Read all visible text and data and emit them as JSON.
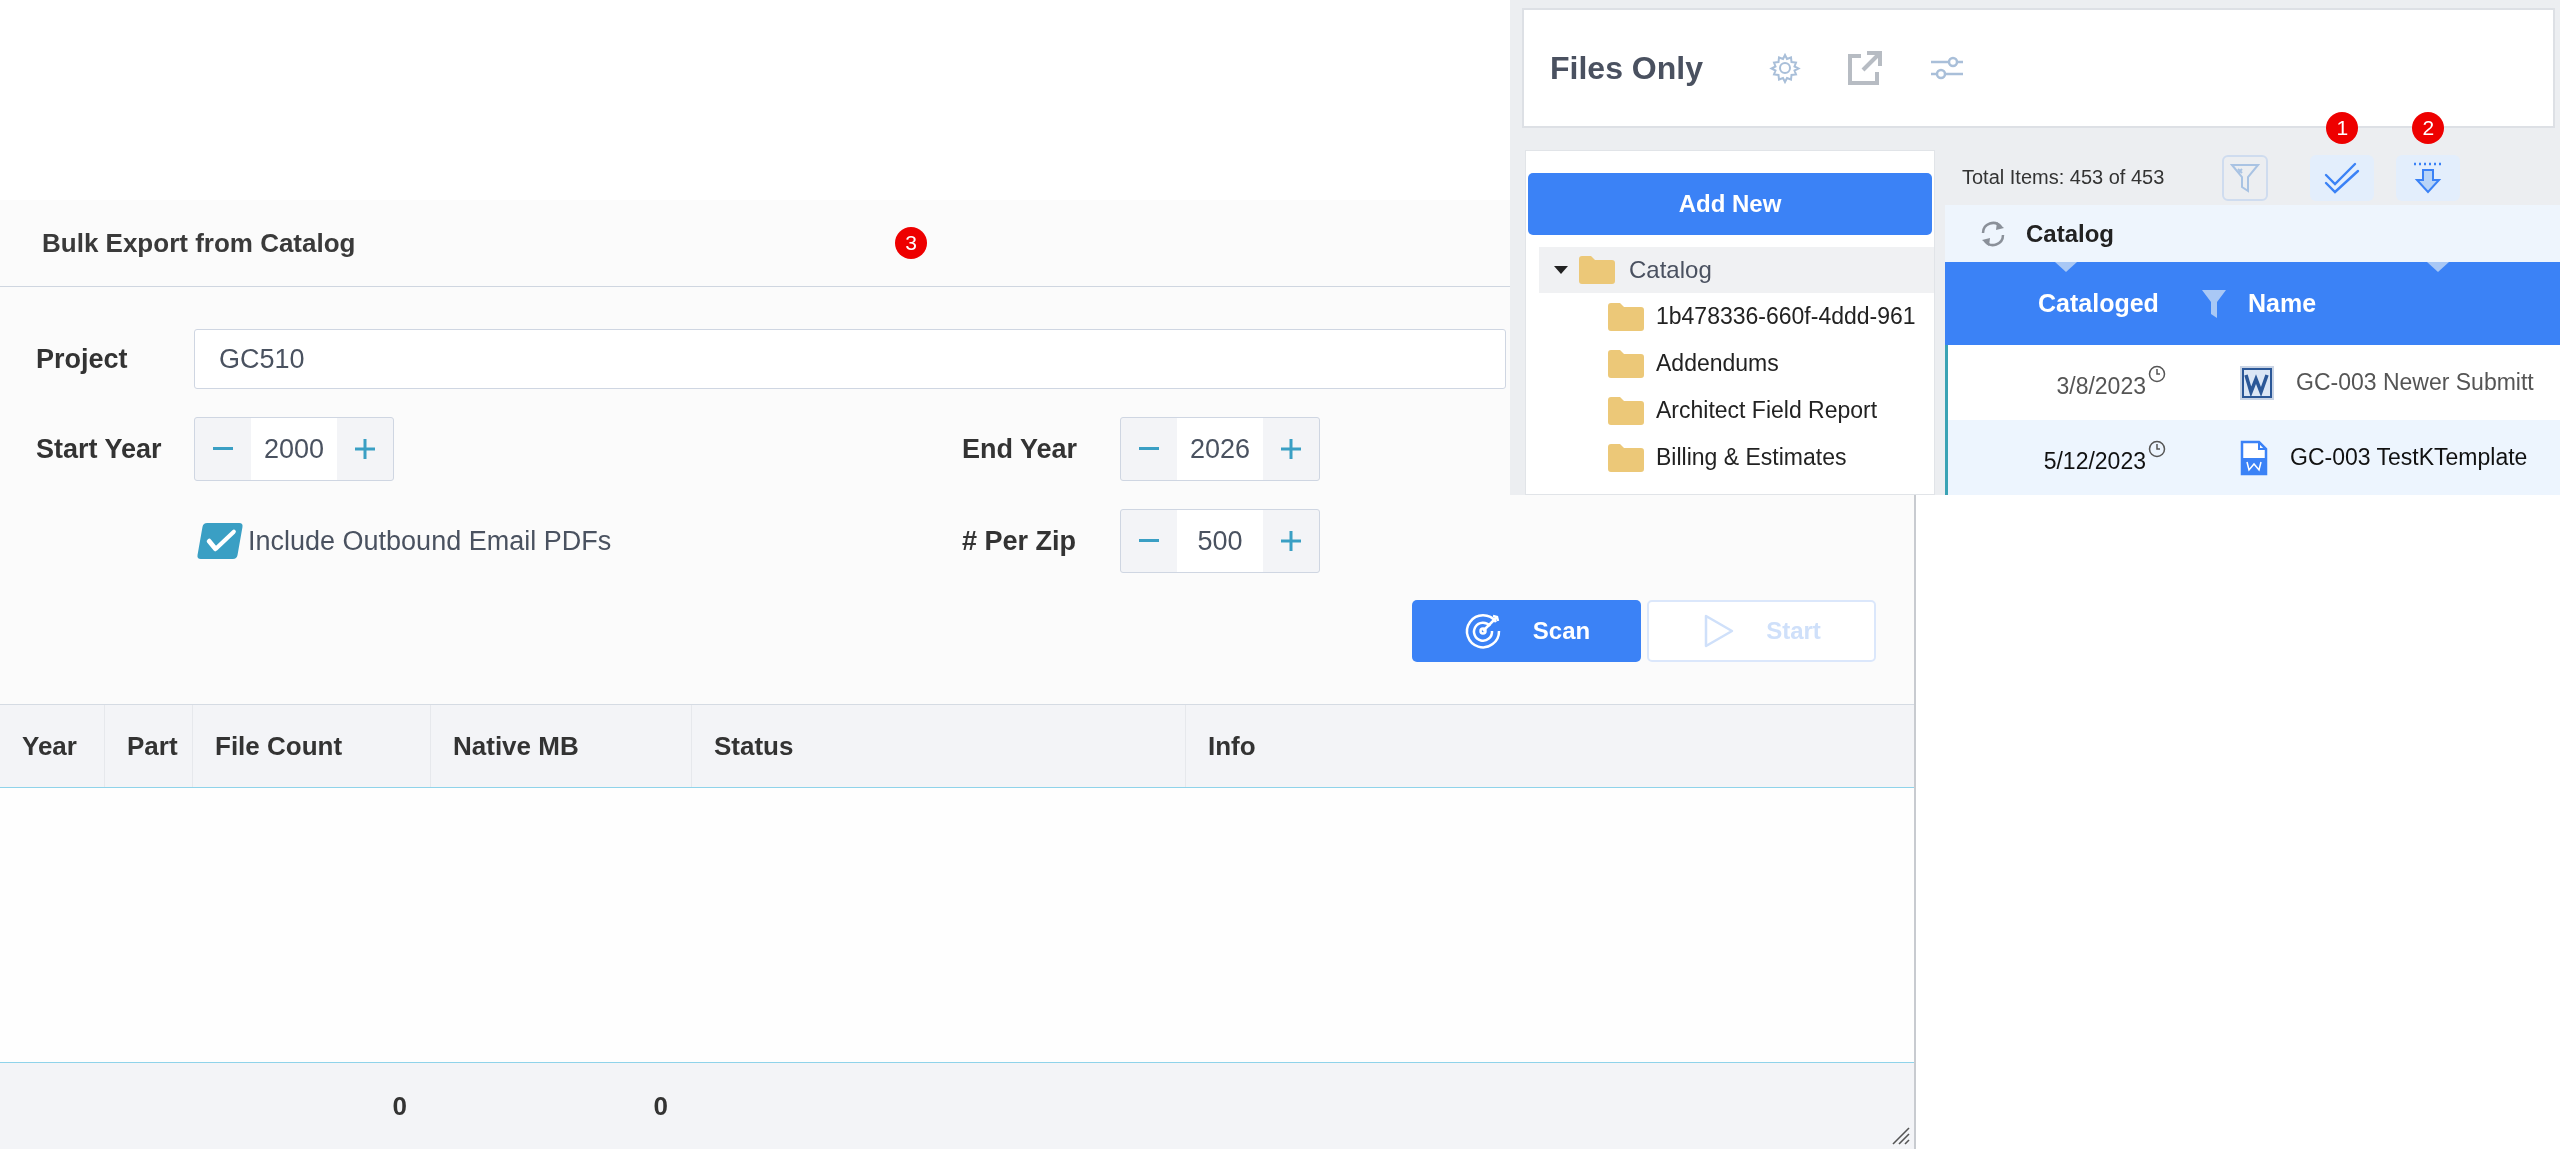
{
  "files_panel": {
    "title": "Files Only",
    "add_button": "Add New",
    "tree": [
      {
        "label": "Catalog",
        "expanded": true,
        "selected": true,
        "children": [
          {
            "label": "1b478336-660f-4ddd-961",
            "selected": false
          },
          {
            "label": "Addendums",
            "selected": false
          },
          {
            "label": "Architect Field Report",
            "selected": false
          },
          {
            "label": "Billing & Estimates",
            "selected": false
          }
        ]
      }
    ],
    "total_items": "Total Items: 453 of 453",
    "toolbar_badges": [
      "1",
      "2"
    ],
    "group_header": "Catalog",
    "columns": [
      "Cataloged",
      "Name"
    ],
    "rows": [
      {
        "cataloged": "3/8/2023",
        "name": "GC-003 Newer Submitt",
        "kind": "word",
        "selected": false
      },
      {
        "cataloged": "5/12/2023",
        "name": "GC-003 TestKTemplate",
        "kind": "docx",
        "selected": true
      }
    ]
  },
  "dialog": {
    "title": "Bulk Export from Catalog",
    "badge": "3",
    "project": {
      "label": "Project",
      "value": "GC510"
    },
    "steppers": [
      {
        "label": "Start Year",
        "value": "2000"
      },
      {
        "label": "End Year",
        "value": "2026"
      },
      {
        "label": "# Per Zip",
        "value": "500"
      }
    ],
    "checkbox": {
      "label": "Include Outbound Email PDFs",
      "checked": true
    },
    "buttons": [
      {
        "label": "Scan",
        "kind": "scan",
        "disabled": false
      },
      {
        "label": "Start",
        "kind": "start",
        "disabled": true
      }
    ],
    "table": {
      "columns": [
        "Year",
        "Part",
        "File Count",
        "Native MB",
        "Status",
        "Info"
      ],
      "totals": {
        "file_count": "0",
        "native_mb": "0"
      }
    }
  }
}
